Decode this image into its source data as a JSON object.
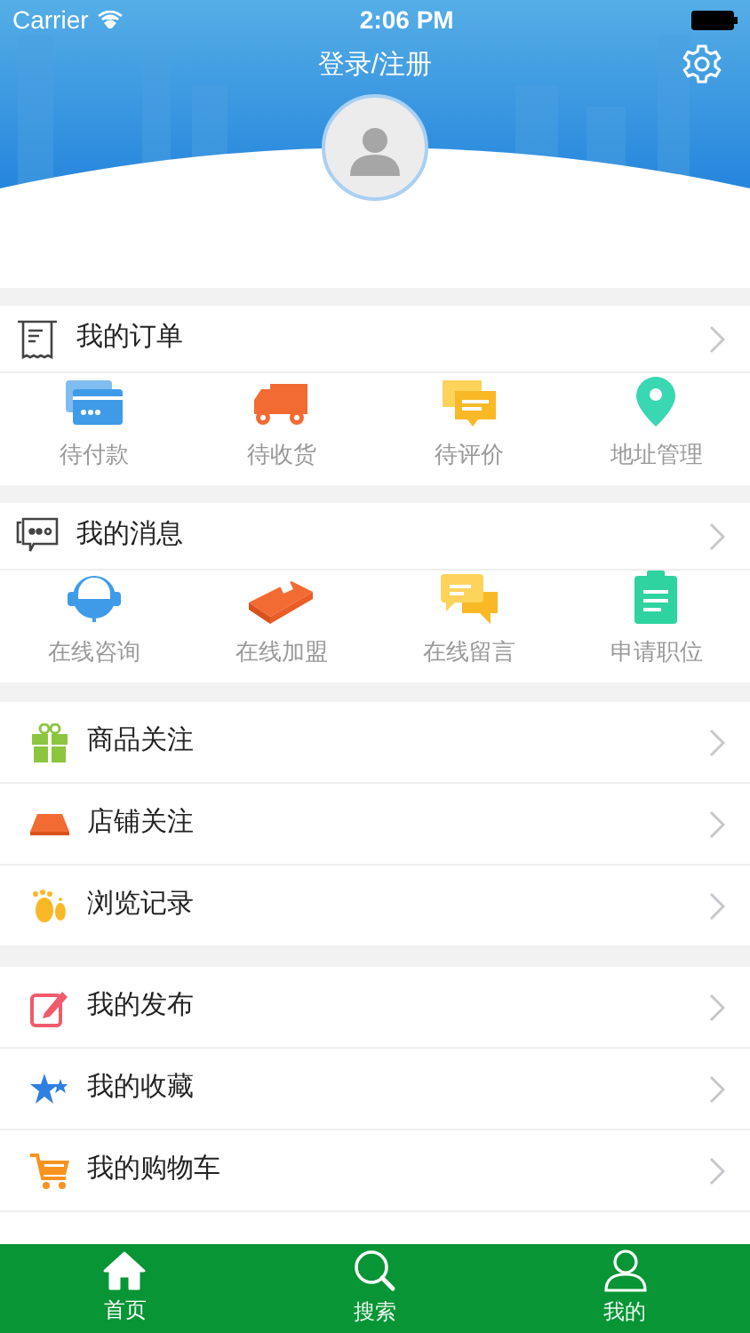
{
  "status_bar": {
    "carrier": "Carrier",
    "time": "2:06 PM"
  },
  "header": {
    "title": "登录/注册"
  },
  "orders": {
    "title": "我的订单",
    "items": [
      {
        "label": "待付款",
        "kind": "card"
      },
      {
        "label": "待收货",
        "kind": "truck"
      },
      {
        "label": "待评价",
        "kind": "comments"
      },
      {
        "label": "地址管理",
        "kind": "pin"
      }
    ]
  },
  "messages": {
    "title": "我的消息",
    "items": [
      {
        "label": "在线咨询",
        "kind": "headset"
      },
      {
        "label": "在线加盟",
        "kind": "money"
      },
      {
        "label": "在线留言",
        "kind": "chat"
      },
      {
        "label": "申请职位",
        "kind": "clipboard"
      }
    ]
  },
  "groups": [
    [
      {
        "label": "商品关注",
        "kind": "gift"
      },
      {
        "label": "店铺关注",
        "kind": "awning"
      },
      {
        "label": "浏览记录",
        "kind": "feet"
      }
    ],
    [
      {
        "label": "我的发布",
        "kind": "edit"
      },
      {
        "label": "我的收藏",
        "kind": "stars"
      },
      {
        "label": "我的购物车",
        "kind": "cart"
      }
    ]
  ],
  "tab_bar": [
    {
      "label": "首页",
      "kind": "home",
      "selected": true
    },
    {
      "label": "搜索",
      "kind": "search",
      "selected": false
    },
    {
      "label": "我的",
      "kind": "user",
      "selected": false
    }
  ]
}
